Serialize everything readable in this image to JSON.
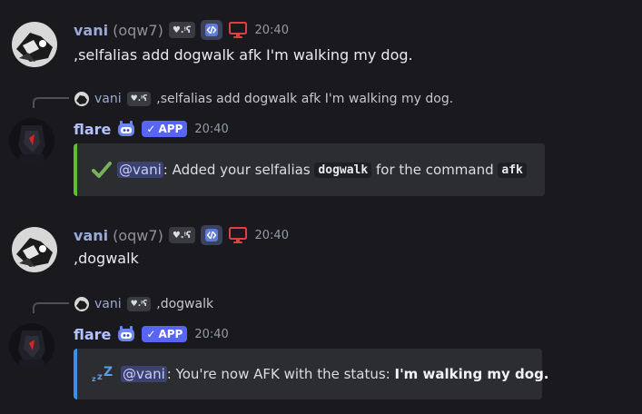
{
  "messages": [
    {
      "author": "vani",
      "nick": "(oqw7)",
      "tag": "♥.ᵎʕ",
      "time": "20:40",
      "content": ",selfalias add dogwalk afk I'm walking my dog."
    },
    {
      "reply": {
        "author": "vani",
        "tag": "♥.ᵎʕ",
        "content": ",selfalias add dogwalk afk I'm walking my dog."
      },
      "author": "flare",
      "badge": "APP",
      "time": "20:40",
      "embed": {
        "mention": "@vani",
        "text_before": ": Added your selfalias ",
        "code1": "dogwalk",
        "text_mid": " for the command ",
        "code2": "afk",
        "icon": "check-mark-icon",
        "accent": "#57c033"
      }
    },
    {
      "author": "vani",
      "nick": "(oqw7)",
      "tag": "♥.ᵎʕ",
      "time": "20:40",
      "content": ",dogwalk"
    },
    {
      "reply": {
        "author": "vani",
        "tag": "♥.ᵎʕ",
        "content": ",dogwalk"
      },
      "author": "flare",
      "badge": "APP",
      "time": "20:40",
      "embed": {
        "mention": "@vani",
        "text_before": ": You're now AFK with the status: ",
        "status": "I'm walking my dog.",
        "icon": "zzz-icon",
        "accent": "#3d8fe6"
      }
    }
  ],
  "colors": {
    "background": "#1a1a1e",
    "embed_bg": "#2b2d31",
    "app_badge": "#5865f2",
    "username_vani": "#9aa9d6",
    "username_flare": "#b3c2ff"
  }
}
